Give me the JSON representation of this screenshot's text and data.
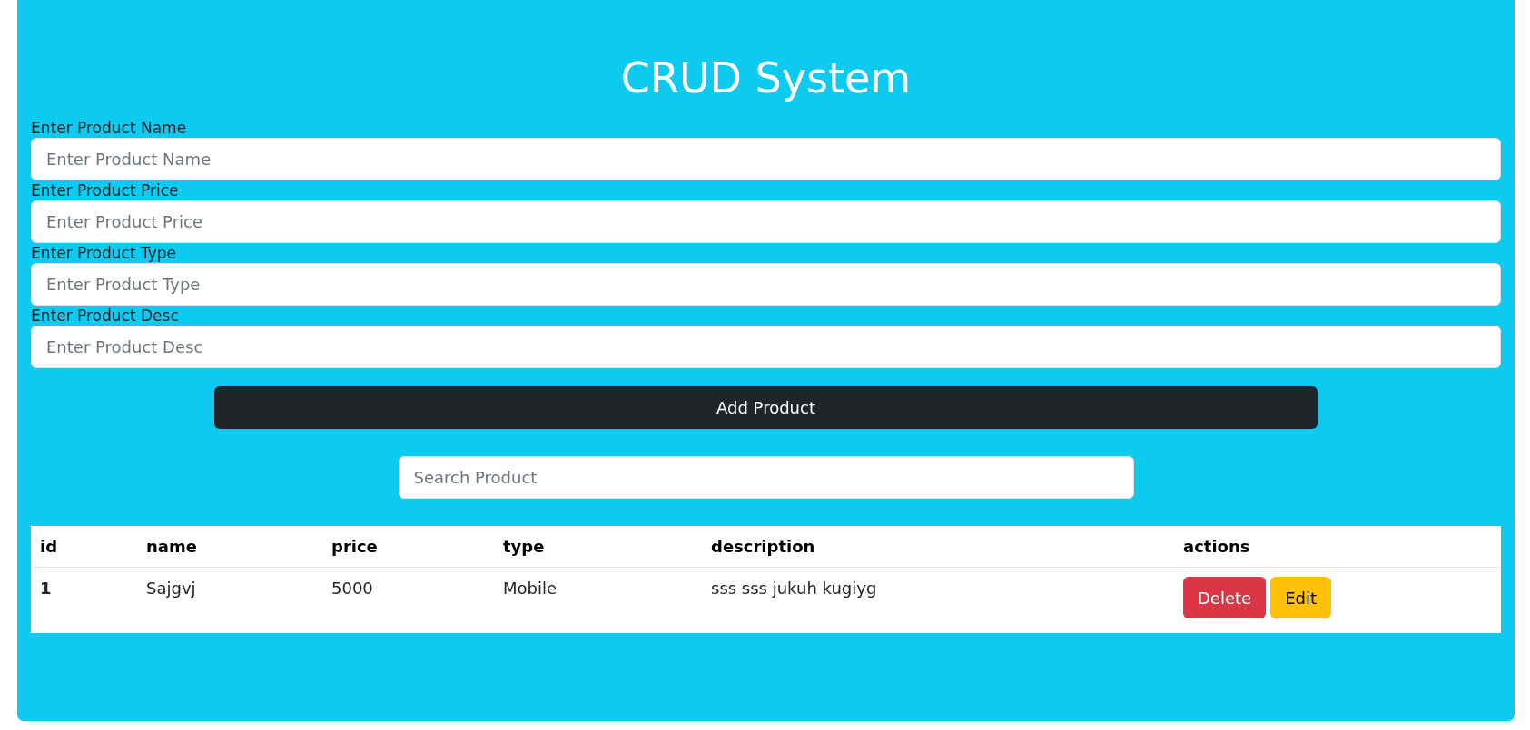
{
  "title": "CRUD System",
  "fields": [
    {
      "label": "Enter Product Name",
      "placeholder": "Enter Product Name"
    },
    {
      "label": "Enter Product Price",
      "placeholder": "Enter Product Price"
    },
    {
      "label": "Enter Product Type",
      "placeholder": "Enter Product Type"
    },
    {
      "label": "Enter Product Desc",
      "placeholder": "Enter Product Desc"
    }
  ],
  "add_button": "Add Product",
  "search": {
    "placeholder": "Search Product"
  },
  "table": {
    "columns": [
      "id",
      "name",
      "price",
      "type",
      "description",
      "actions"
    ],
    "rows": [
      {
        "id": "1",
        "name": "Sajgvj",
        "price": "5000",
        "type": "Mobile",
        "description": "sss sss jukuh kugiyg",
        "actions": [
          {
            "kind": "delete",
            "label": "Delete"
          },
          {
            "kind": "edit",
            "label": "Edit"
          }
        ]
      }
    ]
  }
}
